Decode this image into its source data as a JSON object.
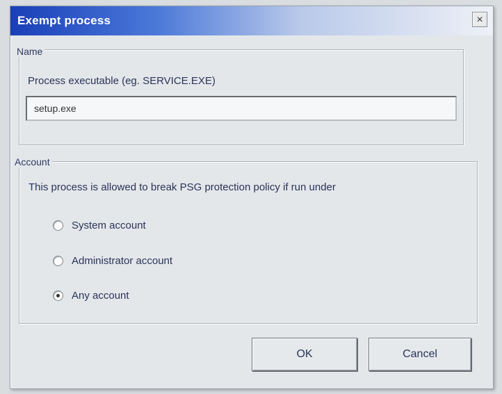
{
  "window": {
    "title": "Exempt process",
    "close_glyph": "×"
  },
  "name_group": {
    "legend": "Name",
    "label": "Process executable (eg. SERVICE.EXE)",
    "value": "setup.exe"
  },
  "account_group": {
    "legend": "Account",
    "description": "This process is allowed to break PSG protection policy if run under",
    "options": [
      {
        "label": "System account",
        "selected": false
      },
      {
        "label": "Administrator account",
        "selected": false
      },
      {
        "label": "Any account",
        "selected": true
      }
    ]
  },
  "buttons": {
    "ok": "OK",
    "cancel": "Cancel"
  },
  "colors": {
    "title_bar_start": "#1a3fb8",
    "dialog_bg": "#e4e7ea",
    "text": "#2a3358"
  },
  "icons": {
    "close": "close-icon"
  }
}
